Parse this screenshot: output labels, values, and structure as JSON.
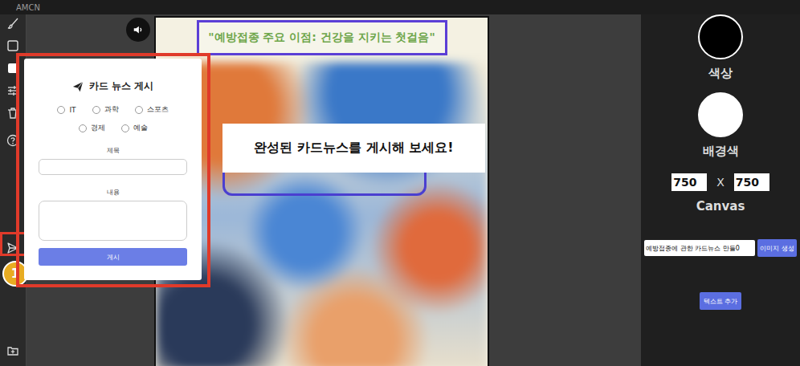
{
  "app": {
    "title": "AMCN"
  },
  "canvas": {
    "title": "\"예방접종 주요 이점: 건강을 지키는 첫걸음\""
  },
  "tooltip": {
    "text": "완성된 카드뉴스를 게시해 보세요!"
  },
  "step_badge": {
    "text": "1"
  },
  "post_panel": {
    "title": "카드 뉴스 게시",
    "categories": [
      {
        "label": "IT",
        "selected": false
      },
      {
        "label": "과학",
        "selected": false
      },
      {
        "label": "스포츠",
        "selected": false
      },
      {
        "label": "경제",
        "selected": false
      },
      {
        "label": "예술",
        "selected": false
      }
    ],
    "fields": [
      {
        "label": "제목",
        "kind": "input",
        "value": ""
      },
      {
        "label": "내용",
        "kind": "textarea",
        "value": ""
      }
    ],
    "submit": "게시"
  },
  "properties": {
    "color": {
      "label": "색상",
      "value": "#000000"
    },
    "background": {
      "label": "배경색",
      "value": "#ffffff"
    },
    "canvas_size": {
      "width": "750",
      "separator": "X",
      "height": "750",
      "label": "Canvas"
    },
    "prompt": {
      "value": "예방접종에 관한 카드뉴스 만들0"
    },
    "generate_button": "이미지 생성",
    "add_text_button": "텍스트 추가"
  }
}
